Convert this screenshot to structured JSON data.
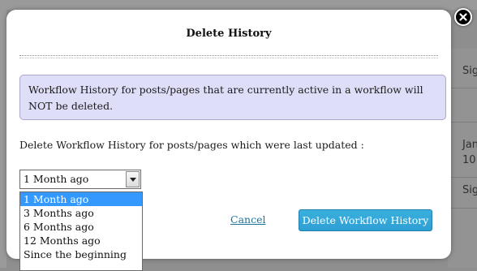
{
  "background": {
    "text_1": "Sig",
    "text_2": "Jan",
    "text_3": "10",
    "text_4": "Sig"
  },
  "dialog": {
    "title": "Delete History",
    "notice": "Workflow History for posts/pages that are currently active in a workflow will NOT be deleted.",
    "prompt": "Delete Workflow History for posts/pages which were last updated :",
    "select": {
      "selected": "1 Month ago",
      "options": [
        "1 Month ago",
        "3 Months ago",
        "6 Months ago",
        "12 Months ago",
        "Since the beginning"
      ],
      "highlighted": "1 Month ago"
    },
    "cancel_label": "Cancel",
    "delete_label": "Delete Workflow History",
    "close_icon": "close-icon"
  },
  "colors": {
    "overlay": "#8f8f8f",
    "notice_bg": "#dedef8",
    "primary_button": "#2ea2cc",
    "link": "#21759b",
    "option_highlight": "#3399ff"
  }
}
